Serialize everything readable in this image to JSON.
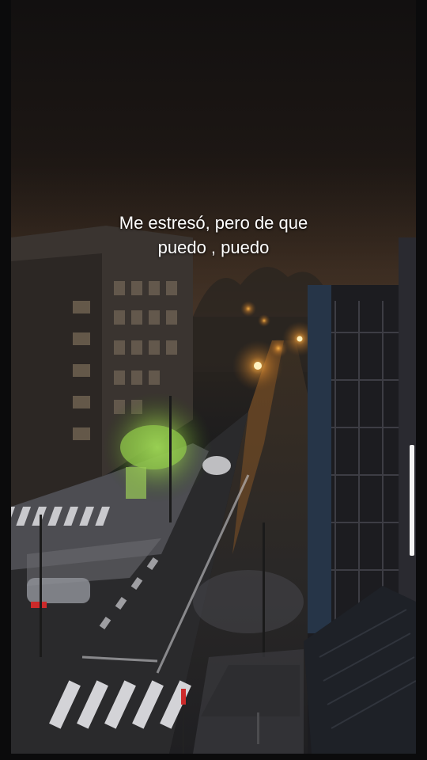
{
  "caption": {
    "line1": "Me estresó, pero de que",
    "line2": "puedo , puedo"
  }
}
